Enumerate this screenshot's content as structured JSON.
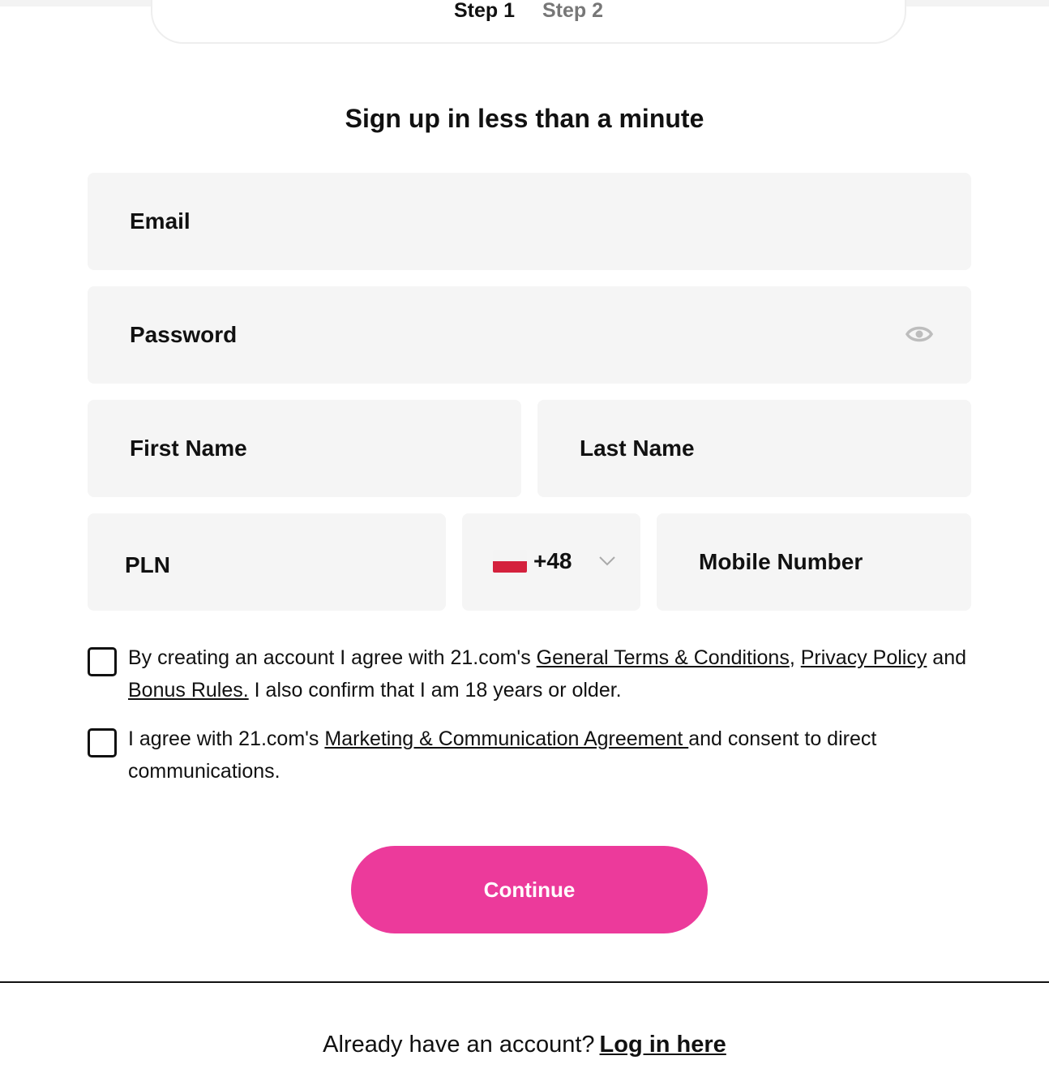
{
  "steps": [
    {
      "label": "Step 1",
      "active": true
    },
    {
      "label": "Step 2",
      "active": false
    }
  ],
  "title": "Sign up in less than a minute",
  "form": {
    "email": {
      "placeholder": "Email",
      "value": ""
    },
    "password": {
      "placeholder": "Password",
      "value": "",
      "toggle_icon": "eye-icon"
    },
    "first_name": {
      "placeholder": "First Name",
      "value": ""
    },
    "last_name": {
      "placeholder": "Last Name",
      "value": ""
    },
    "currency": {
      "value": "PLN"
    },
    "country_code": {
      "value": "+48",
      "flag": "poland-flag-icon"
    },
    "mobile": {
      "placeholder": "Mobile Number",
      "value": ""
    }
  },
  "consent": {
    "terms": {
      "prefix": "By creating an account I agree with 21.com's ",
      "link_terms": "General Terms & Conditions",
      "sep": ", ",
      "link_privacy": "Privacy Policy",
      "and": " and ",
      "link_bonus": "Bonus Rules.",
      "suffix": " I also confirm that I am 18 years or older."
    },
    "marketing": {
      "prefix": "I agree with 21.com's ",
      "link_marketing": "Marketing & Communication Agreement ",
      "suffix": "and consent to direct communications."
    }
  },
  "continue_label": "Continue",
  "footer": {
    "text": "Already have an account?",
    "link": "Log in here"
  },
  "colors": {
    "accent": "#ec3a9b",
    "field_bg": "#f5f5f5",
    "text": "#111111",
    "muted": "#777777"
  }
}
